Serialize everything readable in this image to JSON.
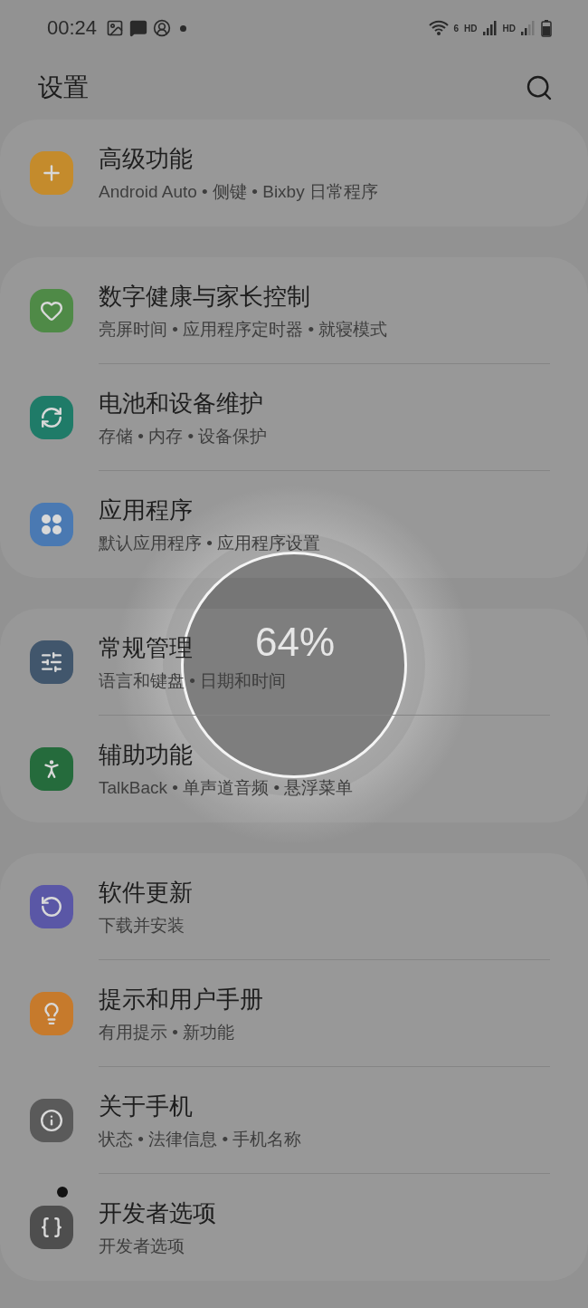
{
  "status_bar": {
    "time": "00:24",
    "wifi_label": "6",
    "network_labels": [
      "HD",
      "HD"
    ]
  },
  "header": {
    "title": "设置"
  },
  "groups": [
    {
      "items": [
        {
          "title": "高级功能",
          "subtitle": "Android Auto • 侧键 • Bixby 日常程序",
          "color": "#c48b2c"
        }
      ]
    },
    {
      "items": [
        {
          "title": "数字健康与家长控制",
          "subtitle": "亮屏时间 • 应用程序定时器 • 就寝模式",
          "color": "#4f8a47"
        },
        {
          "title": "电池和设备维护",
          "subtitle": "存储 • 内存 • 设备保护",
          "color": "#1f7b68"
        },
        {
          "title": "应用程序",
          "subtitle": "默认应用程序 • 应用程序设置",
          "color": "#4a79b2"
        }
      ]
    },
    {
      "items": [
        {
          "title": "常规管理",
          "subtitle": "语言和键盘 • 日期和时间",
          "color": "#41566c"
        },
        {
          "title": "辅助功能",
          "subtitle": "TalkBack • 单声道音频 • 悬浮菜单",
          "color": "#256b3c"
        }
      ]
    },
    {
      "items": [
        {
          "title": "软件更新",
          "subtitle": "下载并安装",
          "color": "#5a57a6"
        },
        {
          "title": "提示和用户手册",
          "subtitle": "有用提示 • 新功能",
          "color": "#c67a2c"
        },
        {
          "title": "关于手机",
          "subtitle": "状态 • 法律信息 • 手机名称",
          "color": "#5a5a5a"
        },
        {
          "title": "开发者选项",
          "subtitle": "开发者选项",
          "color": "#4e4e4e",
          "badge": true
        }
      ]
    }
  ],
  "overlay": {
    "text": "64%"
  }
}
